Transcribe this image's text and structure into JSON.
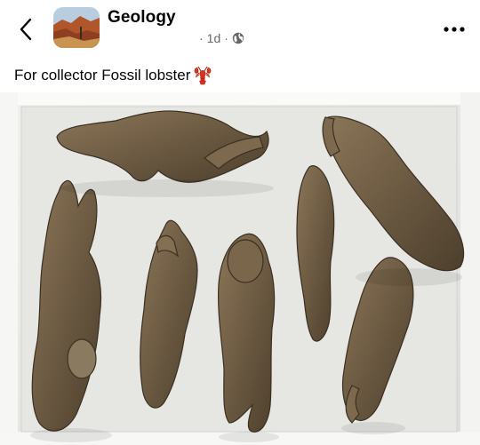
{
  "header": {
    "back_icon": "chevron-left-icon",
    "group_name": "Geology",
    "time_ago": "1d",
    "separator": "·",
    "audience_icon": "globe-icon",
    "more_icon": "more-horizontal-icon"
  },
  "post": {
    "caption": "For collector Fossil lobster",
    "caption_emoji": "lobster-emoji-icon",
    "photo_subject": "fossil-lobster-specimens"
  },
  "colors": {
    "text_primary": "#050505",
    "text_secondary": "#65676b",
    "background": "#ffffff",
    "tray": "#e9e9e6",
    "fossil": "#6f5d45"
  }
}
